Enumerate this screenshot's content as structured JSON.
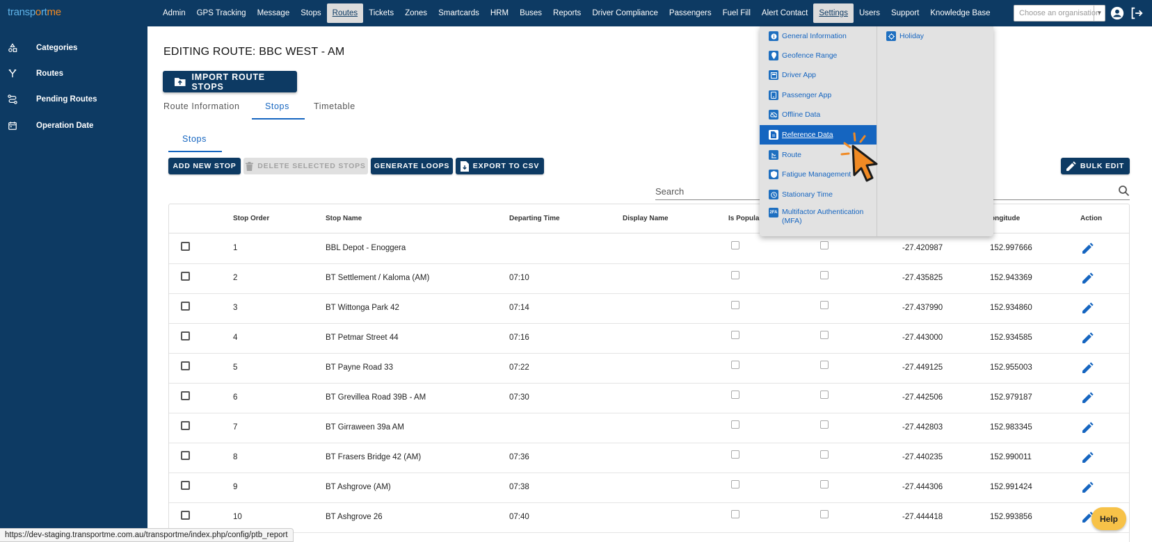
{
  "brand": {
    "part1": "transp",
    "part2": "o",
    "part3": "rt",
    "part4": "me"
  },
  "nav": [
    "Admin",
    "GPS Tracking",
    "Message",
    "Stops",
    "Routes",
    "Tickets",
    "Zones",
    "Smartcards",
    "HRM",
    "Buses",
    "Reports",
    "Driver Compliance",
    "Passengers",
    "Fuel Fill",
    "Alert Contact",
    "Settings",
    "Users",
    "Support",
    "Knowledge Base"
  ],
  "nav_active": [
    "Routes",
    "Settings"
  ],
  "org_select": {
    "placeholder": "Choose an organisation"
  },
  "sidebar": {
    "items": [
      {
        "label": "Categories",
        "icon": "categories-icon"
      },
      {
        "label": "Routes",
        "icon": "routes-icon"
      },
      {
        "label": "Pending Routes",
        "icon": "pending-routes-icon"
      },
      {
        "label": "Operation Date",
        "icon": "calendar-icon"
      }
    ]
  },
  "page": {
    "title": "EDITING ROUTE: BBC WEST - AM",
    "import_label": "IMPORT ROUTE STOPS",
    "tabs": [
      "Route Information",
      "Stops",
      "Timetable"
    ],
    "active_tab": "Stops",
    "subtab": "Stops"
  },
  "toolbar": {
    "add": "ADD NEW STOP",
    "delete": "DELETE SELECTED STOPS",
    "loops": "GENERATE LOOPS",
    "export": "EXPORT TO CSV",
    "bulk": "BULK EDIT"
  },
  "search": {
    "placeholder": "Search"
  },
  "table": {
    "headers": [
      "Stop Order",
      "Stop Name",
      "Departing Time",
      "Display Name",
      "Is Popular",
      "ongitude",
      "Action"
    ],
    "rows": [
      {
        "order": "1",
        "name": "BBL Depot - Enoggera",
        "time": "",
        "display": "",
        "lat": "-27.420987",
        "lng": "152.997666"
      },
      {
        "order": "2",
        "name": "BT Settlement / Kaloma (AM)",
        "time": "07:10",
        "display": "",
        "lat": "-27.435825",
        "lng": "152.943369"
      },
      {
        "order": "3",
        "name": "BT Wittonga Park 42",
        "time": "07:14",
        "display": "",
        "lat": "-27.437990",
        "lng": "152.934860"
      },
      {
        "order": "4",
        "name": "BT Petmar Street 44",
        "time": "07:16",
        "display": "",
        "lat": "-27.443000",
        "lng": "152.934585"
      },
      {
        "order": "5",
        "name": "BT Payne Road 33",
        "time": "07:22",
        "display": "",
        "lat": "-27.449125",
        "lng": "152.955003"
      },
      {
        "order": "6",
        "name": "BT Grevillea Road 39B - AM",
        "time": "07:30",
        "display": "",
        "lat": "-27.442506",
        "lng": "152.979187"
      },
      {
        "order": "7",
        "name": "BT Girraween 39a AM",
        "time": "",
        "display": "",
        "lat": "-27.442803",
        "lng": "152.983345"
      },
      {
        "order": "8",
        "name": "BT Frasers Bridge 42 (AM)",
        "time": "07:36",
        "display": "",
        "lat": "-27.440235",
        "lng": "152.990011"
      },
      {
        "order": "9",
        "name": "BT Ashgrove (AM)",
        "time": "07:38",
        "display": "",
        "lat": "-27.444306",
        "lng": "152.991424"
      },
      {
        "order": "10",
        "name": "BT Ashgrove 26",
        "time": "07:40",
        "display": "",
        "lat": "-27.444418",
        "lng": "152.993856"
      }
    ]
  },
  "settings_menu": {
    "col1": [
      {
        "label": "General Information",
        "icon": "info-icon"
      },
      {
        "label": "Geofence Range",
        "icon": "location-pin-icon"
      },
      {
        "label": "Driver App",
        "icon": "driver-app-icon"
      },
      {
        "label": "Passenger App",
        "icon": "passenger-app-icon"
      },
      {
        "label": "Offline Data",
        "icon": "cloud-off-icon"
      },
      {
        "label": "Reference Data",
        "icon": "document-icon"
      },
      {
        "label": "Route",
        "icon": "route-icon"
      },
      {
        "label": "Fatigue Management",
        "icon": "shield-icon"
      },
      {
        "label": "Stationary Time",
        "icon": "clock-icon"
      },
      {
        "label": "Multifactor Authentication (MFA)",
        "icon": "2fa-icon"
      }
    ],
    "col2": [
      {
        "label": "Holiday",
        "icon": "holiday-icon"
      }
    ],
    "active": "Reference Data"
  },
  "status_url": "https://dev-staging.transportme.com.au/transportme/index.php/config/ptb_report",
  "help_label": "Help",
  "colors": {
    "navy": "#0d3a63",
    "link_blue": "#1565c0",
    "accent_orange": "#f08a24",
    "help_yellow": "#f7c248"
  }
}
